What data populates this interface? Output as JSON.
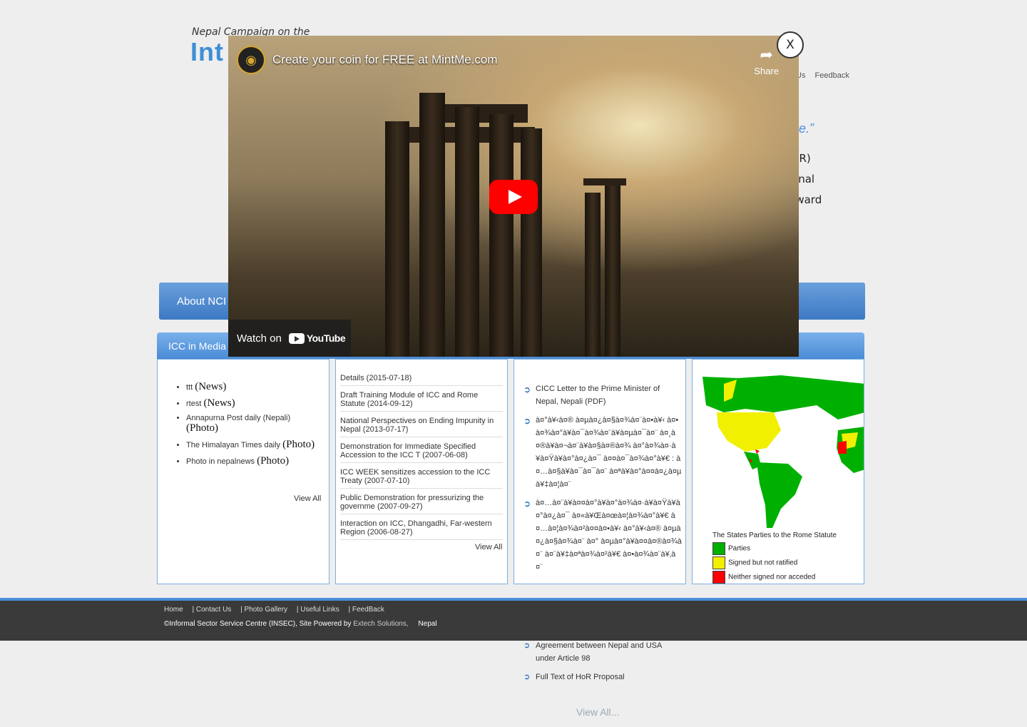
{
  "header": {
    "logo_line1": "Nepal Campaign on the",
    "logo_line2": "Int",
    "toplinks": [
      "Us",
      "Feedback"
    ],
    "quote_fragment": "me.”",
    "side_fragments": [
      "HoR)",
      "tional",
      "orward"
    ]
  },
  "nav": {
    "first_item": "About NCI"
  },
  "panel": {
    "title": "ICC in Media"
  },
  "media": {
    "items": [
      {
        "name": "ttt",
        "tag": "(News)"
      },
      {
        "name": "rtest",
        "tag": "(News)"
      },
      {
        "name": "Annapurna Post daily (Nepali)",
        "tag": "(Photo)"
      },
      {
        "name": "The Himalayan Times daily",
        "tag": "(Photo)"
      },
      {
        "name": "Photo in nepalnews",
        "tag": "(Photo)"
      }
    ],
    "view_all": "View All"
  },
  "events": {
    "items": [
      "Details  (2015-07-18)",
      "Draft Training Module of ICC and Rome Statute  (2014-09-12)",
      "National Perspectives on Ending Impunity in Nepal  (2013-07-17)",
      "Demonstration for Immediate Specified Accession to the ICC T  (2007-06-08)",
      "ICC WEEK sensitizes accession to the ICC Treaty  (2007-07-10)",
      "Public Demonstration for pressurizing the governme  (2007-09-27)",
      "Interaction on ICC, Dhangadhi, Far-western Region  (2006-08-27)"
    ],
    "view_all": "View All"
  },
  "documents": {
    "items": [
      "CICC Letter to the Prime Minister of Nepal, Nepali (PDF)",
      "à¤°à¥‹à¤® à¤µà¤¿à¤§à¤¾à¤¨à¤•à¥‹ à¤•à¤¾à¤°à¥à¤¯à¤¾à¤¨à¥à¤µà¤¯à¤¨ à¤¸à¤®à¥à¤¬à¤¨à¥à¤§à¤®à¤¾ à¤°à¤¾à¤·à¥à¤Ÿà¥à¤°à¤¿à¤¯ à¤¤à¤¯à¤¾à¤°à¥€ : à¤…à¤§à¥à¤¯à¤¯à¤¨ à¤ªà¥à¤°à¤¤à¤¿à¤µà¥‡à¤¦à¤¨",
      "à¤…à¤¨à¥à¤¤à¤°à¥à¤°à¤¾à¤·à¥à¤Ÿà¥à¤°à¤¿à¤¯ à¤«à¥Œà¤œà¤¦à¤¾à¤°à¥€ à¤…à¤¦à¤¾à¤²à¤¤à¤•à¥‹ à¤°à¥‹à¤® à¤µà¤¿à¤§à¤¾à¤¨ à¤° à¤µà¤°à¥à¤¤à¤®à¤¾à¤¨ à¤¨à¥‡à¤ªà¤¾à¤²à¥€ à¤•à¤¾à¤¨à¥‚à¤¨",
      "Agreement between Nepal and USA under Article 98",
      "Full Text of HoR Proposal"
    ],
    "view_all": "View All..."
  },
  "map_legend": {
    "title": "The States Parties to the Rome Statute",
    "entries": [
      {
        "label": "Parties",
        "color": "#00b000"
      },
      {
        "label": "Signed but not ratified",
        "color": "#f0f000"
      },
      {
        "label": "Neither signed nor acceded",
        "color": "#ff0000"
      }
    ]
  },
  "footer": {
    "links": [
      "Home",
      "| Contact Us",
      "| Photo Gallery",
      "| Useful Links",
      "| FeedBack"
    ],
    "copyright": "©Informal Sector Service Centre (INSEC), Site Powered by",
    "powered_by": "Extech Solutions,",
    "location": "Nepal"
  },
  "video": {
    "title": "Create your coin for FREE at MintMe.com",
    "share_label": "Share",
    "watch_on": "Watch on",
    "youtube": "YouTube",
    "close_label": "X"
  },
  "colors": {
    "accent": "#4a8cd6",
    "youtube_red": "#ff0000"
  }
}
